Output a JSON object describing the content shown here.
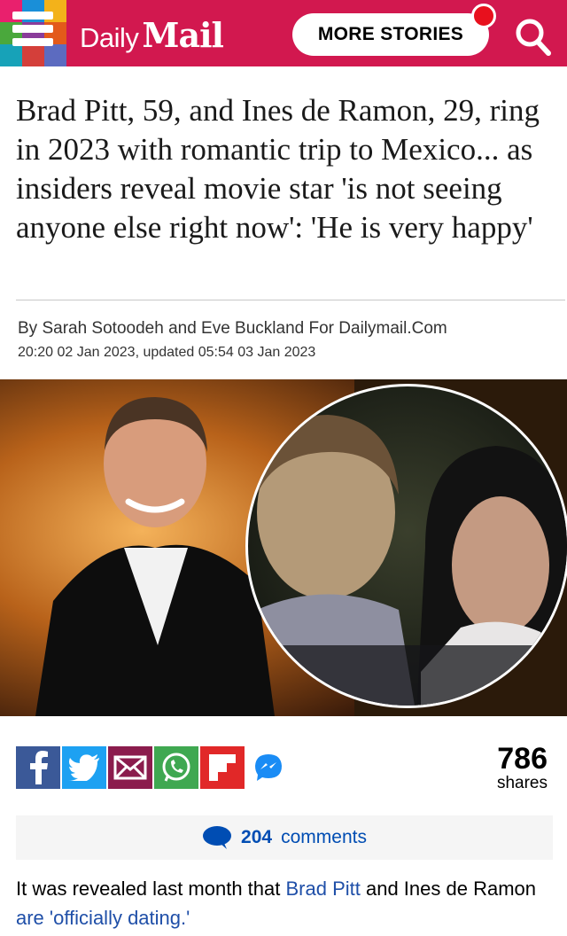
{
  "header": {
    "brand_daily": "Daily",
    "brand_mail": "Mail",
    "more_stories": "MORE STORIES",
    "colors": {
      "bar": "#d2184f",
      "notification": "#e8101d"
    }
  },
  "article": {
    "headline": "Brad Pitt, 59, and Ines de Ramon, 29, ring in 2023 with romantic trip to Mexico... as insiders reveal movie star 'is not seeing anyone else right now': 'He is very happy'",
    "byline": "By Sarah Sotoodeh and Eve Buckland For Dailymail.Com",
    "dateline": "20:20 02 Jan 2023, updated 05:54 03 Jan 2023"
  },
  "share": {
    "buttons": [
      "facebook-icon",
      "twitter-icon",
      "email-icon",
      "whatsapp-icon",
      "flipboard-icon",
      "messenger-icon"
    ],
    "count": "786",
    "count_label": "shares"
  },
  "comments": {
    "count": "204",
    "label": "comments"
  },
  "body": {
    "p1_a": "It was revealed last month that ",
    "p1_link1": "Brad Pitt",
    "p1_b": " and Ines de Ramon ",
    "p1_link2": "are 'officially dating.'"
  }
}
